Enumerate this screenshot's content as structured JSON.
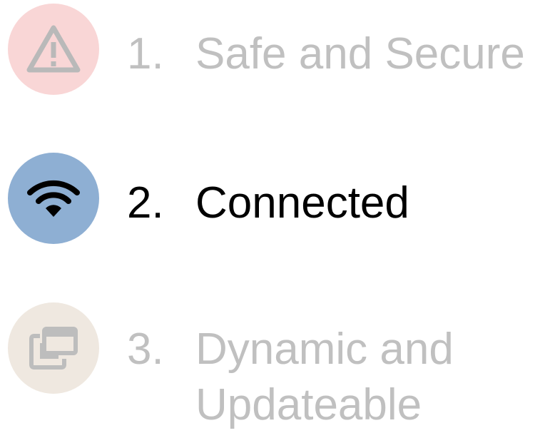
{
  "items": [
    {
      "number": "1.",
      "label": "Safe and Secure",
      "icon": "warning-icon",
      "circle_color": "#f9d6d6",
      "text_color": "#c0c0c0",
      "icon_color": "#b9b9b9"
    },
    {
      "number": "2.",
      "label": "Connected",
      "icon": "wifi-icon",
      "circle_color": "#8eafd3",
      "text_color": "#000000",
      "icon_color": "#000000"
    },
    {
      "number": "3.",
      "label_line1": "Dynamic and",
      "label_line2": "Updateable",
      "icon": "windows-stack-icon",
      "circle_color": "#efe8e0",
      "text_color": "#c0c0c0",
      "icon_color": "#bdbdbd"
    }
  ]
}
